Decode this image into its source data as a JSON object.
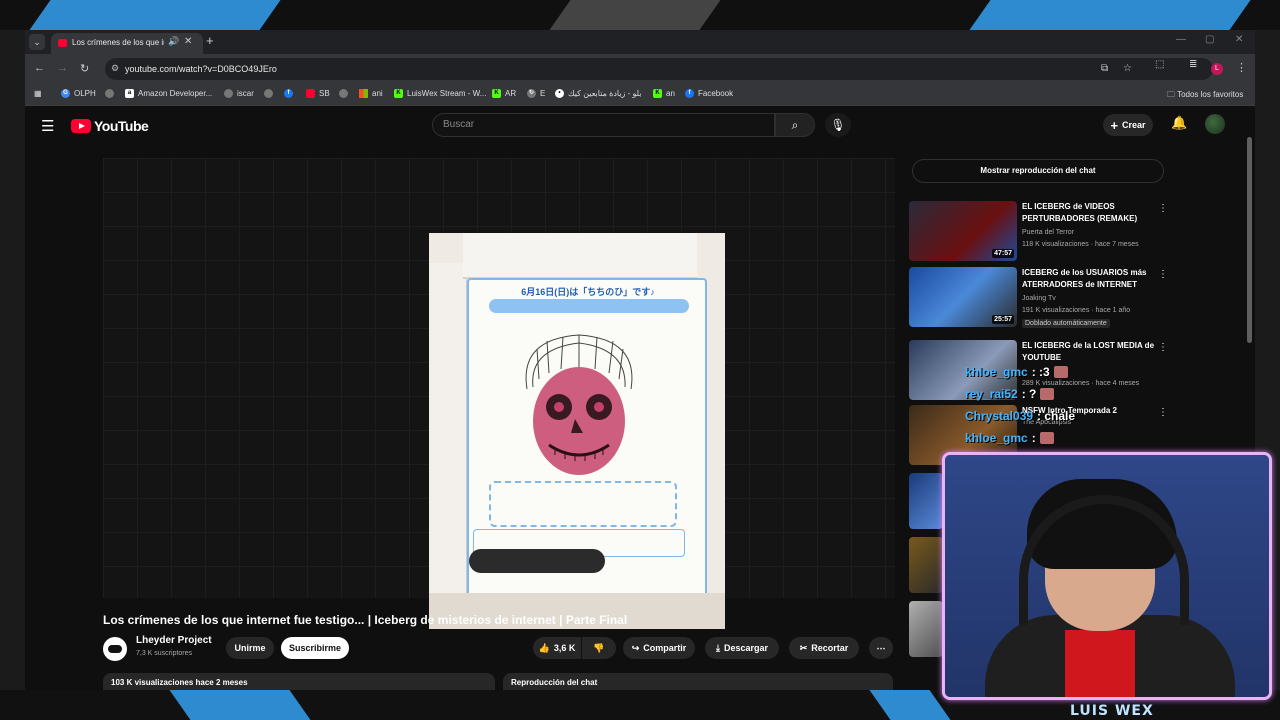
{
  "browser": {
    "tab_title": "Los crímenes de los que internet",
    "url": "youtube.com/watch?v=D0BCO49JEro",
    "bookmarks": [
      {
        "label": "OLPH",
        "icon": "google-icon",
        "color": "#4285f4"
      },
      {
        "label": "",
        "icon": "globe-icon",
        "color": "#777777"
      },
      {
        "label": "Amazon Developer...",
        "icon": "amazon-icon",
        "color": "#ffffff"
      },
      {
        "label": "iscar",
        "icon": "globe-icon",
        "color": "#777777"
      },
      {
        "label": "",
        "icon": "globe-icon",
        "color": "#777777"
      },
      {
        "label": "",
        "icon": "facebook-icon",
        "color": "#1877f2"
      },
      {
        "label": "SB",
        "icon": "youtube-icon",
        "color": "#ff0033"
      },
      {
        "label": "",
        "icon": "globe-icon",
        "color": "#777777"
      },
      {
        "label": "ani",
        "icon": "microsoft-icon",
        "color": "#f25022"
      },
      {
        "label": "LuisWex Stream - W...",
        "icon": "kick-icon",
        "color": "#53fc18"
      },
      {
        "label": "AR",
        "icon": "kick-icon",
        "color": "#53fc18"
      },
      {
        "label": "E",
        "icon": "refresh-icon",
        "color": "#777777"
      },
      {
        "label": "بلو - زيادة متابعين كيك",
        "icon": "circle-icon",
        "color": "#ffffff"
      },
      {
        "label": "an",
        "icon": "kick-icon",
        "color": "#53fc18"
      },
      {
        "label": "Facebook",
        "icon": "facebook-icon",
        "color": "#1877f2"
      }
    ],
    "all_bookmarks": "Todos los favoritos",
    "profile_initial": "L"
  },
  "youtube": {
    "logo": "YouTube",
    "search_placeholder": "Buscar",
    "create_label": "Crear",
    "video_title": "Los crímenes de los que internet fue testigo... | Iceberg de misterios de internet | Parte Final",
    "channel_name": "Lheyder Project",
    "channel_subs": "7,3 K suscriptores",
    "join_label": "Unirme",
    "subscribe_label": "Suscribirme",
    "likes": "3,6 K",
    "share_label": "Compartir",
    "download_label": "Descargar",
    "clip_label": "Recortar",
    "views_date": "103 K visualizaciones  hace 2 meses",
    "chat_replay_label": "Reproducción del chat",
    "show_chat_label": "Mostrar reproducción del chat",
    "video_card_text": "6月16日(日)は「ちちのひ」です♪",
    "recommendations": [
      {
        "title": "EL ICEBERG de VIDEOS PERTURBADORES (REMAKE)",
        "channel": "Puerta del Terror",
        "stats": "118 K visualizaciones · hace 7 meses",
        "duration": "47:57",
        "badge": ""
      },
      {
        "title": "ICEBERG de los USUARIOS más ATERRADORES de INTERNET",
        "channel": "Joaking Tv",
        "stats": "191 K visualizaciones · hace 1 año",
        "duration": "25:57",
        "badge": "Doblado automáticamente"
      },
      {
        "title": "EL ICEBERG de la LOST MEDIA de YOUTUBE",
        "channel": "",
        "stats": "289 K visualizaciones · hace 4 meses",
        "duration": "",
        "badge": ""
      },
      {
        "title": "NSFW Intro Temporada 2",
        "channel": "The Apocalipsis",
        "stats": "",
        "duration": "",
        "badge": ""
      }
    ]
  },
  "stream_chat": [
    {
      "user": "khloe_gmc",
      "message": ": :3"
    },
    {
      "user": "rey_rai52",
      "message": ": ?"
    },
    {
      "user": "Chrystal039",
      "message": ": chale"
    },
    {
      "user": "khloe_gmc",
      "message": ":"
    }
  ],
  "streamer_name": "LUIS WEX",
  "colors": {
    "youtube_red": "#ff0033",
    "chat_username": "#45b4ff",
    "cam_border": "#e9b3f5",
    "stream_accent": "#2e8bd0"
  }
}
